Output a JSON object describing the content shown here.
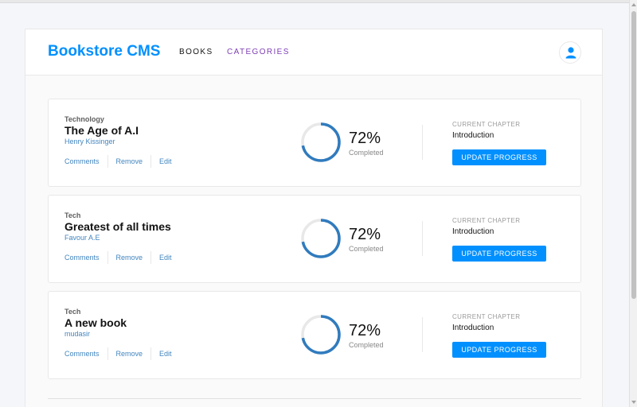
{
  "header": {
    "brand": "Bookstore CMS",
    "nav": [
      "BOOKS",
      "CATEGORIES"
    ],
    "user_icon": "user-icon"
  },
  "books": [
    {
      "category": "Technology",
      "title": "The Age of A.I",
      "author": "Henry Kissinger",
      "actions": [
        "Comments",
        "Remove",
        "Edit"
      ],
      "progress_percent": 72,
      "percent_label": "72%",
      "completed_label": "Completed",
      "chapter_label": "CURRENT CHAPTER",
      "chapter": "Introduction",
      "button": "UPDATE PROGRESS"
    },
    {
      "category": "Tech",
      "title": "Greatest of all times",
      "author": "Favour A.E",
      "actions": [
        "Comments",
        "Remove",
        "Edit"
      ],
      "progress_percent": 72,
      "percent_label": "72%",
      "completed_label": "Completed",
      "chapter_label": "CURRENT CHAPTER",
      "chapter": "Introduction",
      "button": "UPDATE PROGRESS"
    },
    {
      "category": "Tech",
      "title": "A new book",
      "author": "mudasir",
      "actions": [
        "Comments",
        "Remove",
        "Edit"
      ],
      "progress_percent": 72,
      "percent_label": "72%",
      "completed_label": "Completed",
      "chapter_label": "CURRENT CHAPTER",
      "chapter": "Introduction",
      "button": "UPDATE PROGRESS"
    }
  ],
  "colors": {
    "accent": "#0290ff",
    "progress": "#307bbe",
    "link": "#4386bf",
    "category_link": "#7d3fb5"
  }
}
